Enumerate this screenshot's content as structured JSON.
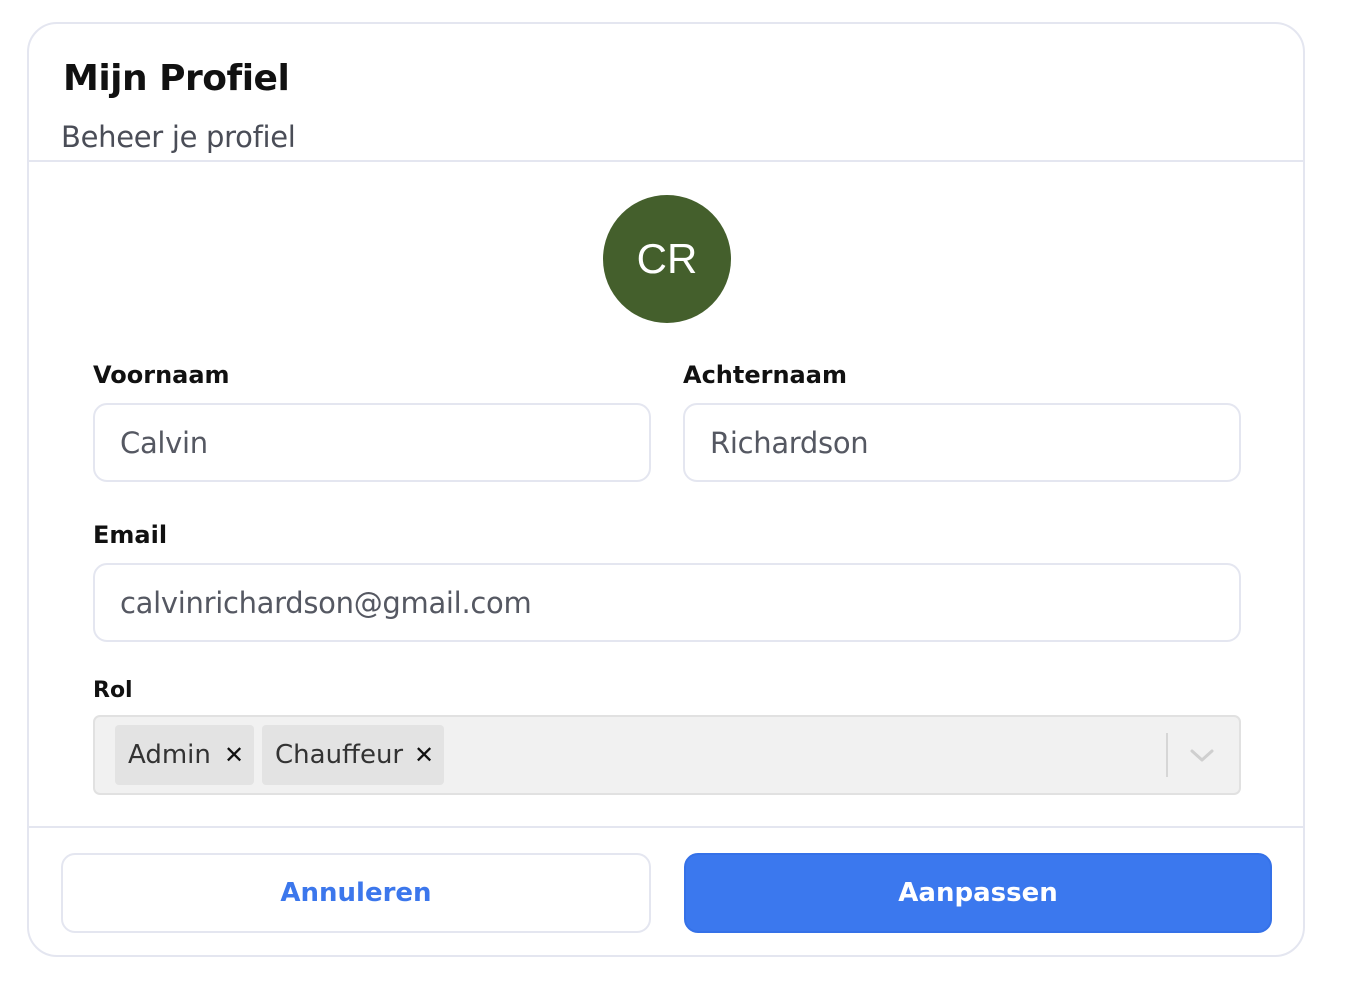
{
  "header": {
    "title": "Mijn Profiel",
    "subtitle": "Beheer je profiel"
  },
  "avatar": {
    "initials": "CR",
    "color": "#445f2c"
  },
  "form": {
    "first_name": {
      "label": "Voornaam",
      "value": "Calvin"
    },
    "last_name": {
      "label": "Achternaam",
      "value": "Richardson"
    },
    "email": {
      "label": "Email",
      "value": "calvinrichardson@gmail.com"
    },
    "role": {
      "label": "Rol",
      "selected": [
        {
          "label": "Admin",
          "remove_icon": "close-icon"
        },
        {
          "label": "Chauffeur",
          "remove_icon": "close-icon"
        }
      ],
      "dropdown_icon": "chevron-down-icon"
    }
  },
  "footer": {
    "cancel_label": "Annuleren",
    "save_label": "Aanpassen"
  },
  "colors": {
    "accent": "#3b78ee",
    "border": "#e4e6f0"
  }
}
